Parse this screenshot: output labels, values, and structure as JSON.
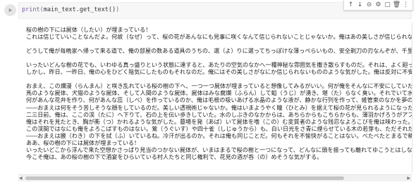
{
  "cell": {
    "code_fn": "print",
    "code_open": "(",
    "code_arg": "main_text.get_text()",
    "code_close": ")"
  },
  "toolbar": {
    "items": [
      "↑",
      "↓",
      "⊝",
      "⚙",
      "▢",
      "🗑",
      "⋮"
    ],
    "item_names": [
      "move-up-icon",
      "move-down-icon",
      "link-icon",
      "settings-icon",
      "mirror-cell-icon",
      "delete-icon",
      "more-icon"
    ]
  },
  "output_lines": [
    "桜の樹の下には屍体（したい）が埋まっている！",
    "これは信じていいことなんだよ。何故（なぜ）って、桜の花があんなにも見事に咲くなんて信じられないことじゃないか。俺はあの美しさが信じられないの",
    "",
    "どうして俺が毎晩家へ帰って来る道で、俺の部屋の数ある道具のうちの、選（よ）りに選ってちっぽけな薄っぺらいもの、安全剃刀の刃なんぞが、千里眼の",
    "",
    "いったいどんな樹の花でも、いわゆる真っ盛りという状態に達すると、あたりの空気のなかへ一種神秘な雰囲気を撒き散らすものだ。それは、よく廻った独楽",
    "しかし、昨日、一昨日、俺の心をひどく陰気にしたものもそれなのだ。俺にはその美しさがなにか信じられないもののような気がした。俺は反対に不安になり",
    "",
    "おまえ、この爛漫（らんまん）と咲き乱れている桜の樹の下へ、一つ一つ屍体が埋まっていると想像してみるがいい。何が俺をそんなに不安にしていたかがお",
    "馬のような屍体、犬猫のような屍体、そして人間のような屍体、屍体はみな腐爛（ふらん）して蛆（うじ）が湧き、堪（た）らなく臭い。それでいて水晶の",
    "何があんな花弁を作り、何があんな蕊（しべ）を作っているのか、俺は毛根の吸いあげる水晶のような液が、静かな行列を作って、維管束のなかを夢のように",
    "――おまえは何をそう苦しそうな顔をしているのだ。美しい透視術じゃないか。俺はいまようやく瞳（ひとみ）を据えて桜の花が見られるようになったのだ",
    "二三日前、俺は、ここの渓（たに）へ下りて、石の上を伝い歩きしていた。水のしぶきのなかからは、あちらからもこちらからも、薄羽かげろうがアフロディ",
    "俺はそれを見たとき、胸が衝（つ）かれるような気がした。墓場を発（あば）いて屍体を嗜（この）む変質者のような残忍なよろこびを俺は味わった。",
    "この渓間ではなにも俺をよろこばすものはない。鶯（うぐいす）や四十雀（しじゅうから）も、白い日光をさ青に煙らせている木の若芽も、ただそれだけで",
    "――おまえは腋（わき）の下を拭（ふ）いているね。冷汗が出るのか。それは俺も同じことだ。何もそれを不愉快がることはない。べたべたとまるで精液の",
    "ああ、桜の樹の下には屍体が埋まっている！",
    "いったいどこから浮んで来た空想かさっぱり見当のつかない屍体が、いまはまるで桜の樹と一つになって、どんなに頭を振っても離れてゆこうとはしない。",
    "今こそ俺は、あの桜の樹の下で酒宴をひらいている村人たちと同じ権利で、花見の酒が呑（の）めそうな気がする。"
  ]
}
